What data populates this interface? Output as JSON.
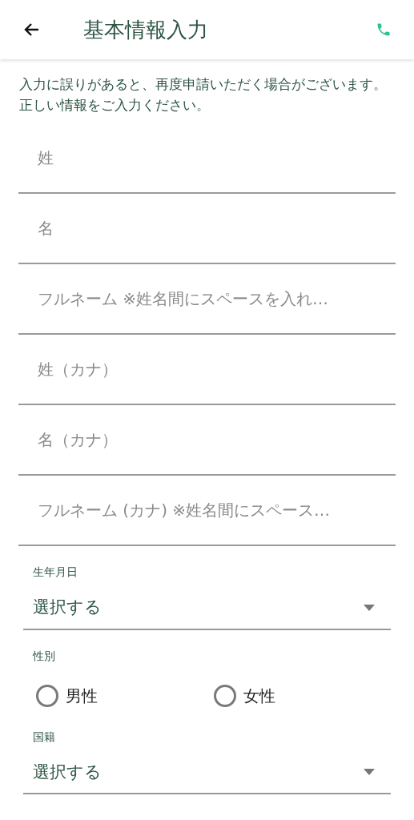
{
  "header": {
    "title": "基本情報入力"
  },
  "notice": "入力に誤りがあると、再度申請いただく場合がございます。正しい情報をご入力ください。",
  "fields": [
    {
      "placeholder": "姓"
    },
    {
      "placeholder": "名"
    },
    {
      "placeholder": "フルネーム ※姓名間にスペースを入れ…"
    },
    {
      "placeholder": "姓（カナ）"
    },
    {
      "placeholder": "名（カナ）"
    },
    {
      "placeholder": "フルネーム (カナ) ※姓名間にスペース…"
    }
  ],
  "birth_date": {
    "label": "生年月日",
    "value": "選択する"
  },
  "gender": {
    "label": "性別",
    "options": [
      {
        "label": "男性",
        "selected": false
      },
      {
        "label": "女性",
        "selected": false
      }
    ]
  },
  "nationality": {
    "label": "国籍",
    "value": "選択する"
  }
}
